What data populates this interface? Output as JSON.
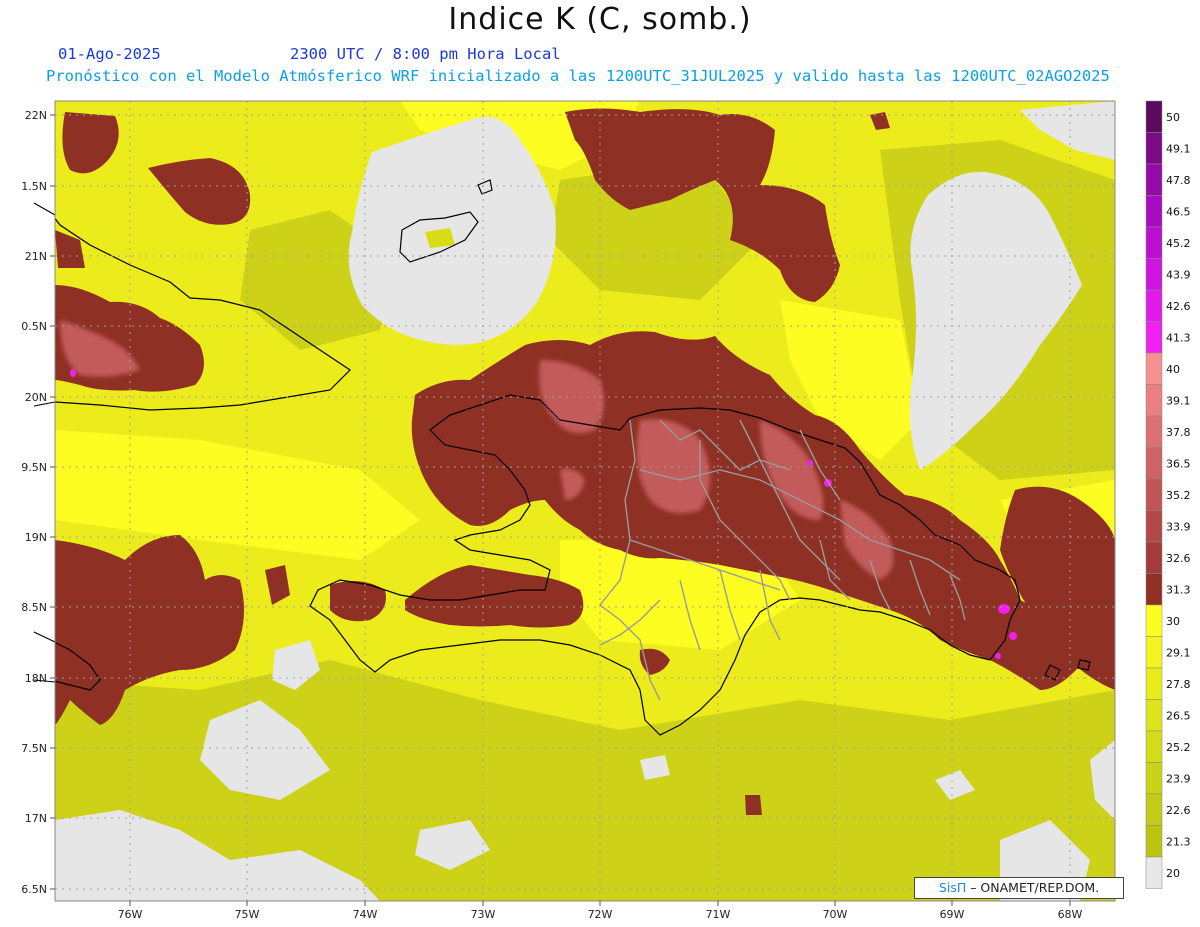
{
  "header": {
    "title": "Indice K (C, somb.)",
    "date": "01-Ago-2025",
    "time": "2300 UTC / 8:00 pm Hora Local",
    "description": "Pronóstico con el Modelo Atmósferico WRF inicializado a las 1200UTC_31JUL2025 y valido hasta las  1200UTC_02AGO2025"
  },
  "axes": {
    "lat_labels": [
      "22N",
      "1.5N",
      "21N",
      "0.5N",
      "20N",
      "9.5N",
      "19N",
      "8.5N",
      "18N",
      "7.5N",
      "17N",
      "6.5N"
    ],
    "lon_labels": [
      "76W",
      "75W",
      "74W",
      "73W",
      "72W",
      "71W",
      "70W",
      "69W",
      "68W"
    ]
  },
  "colorbar": {
    "labels": [
      "50",
      "49.1",
      "47.8",
      "46.5",
      "45.2",
      "43.9",
      "42.6",
      "41.3",
      "40",
      "39.1",
      "37.8",
      "36.5",
      "35.2",
      "33.9",
      "32.6",
      "31.3",
      "30",
      "29.1",
      "27.8",
      "26.5",
      "25.2",
      "23.9",
      "22.6",
      "21.3",
      "20"
    ],
    "colors": [
      "#5c0a5e",
      "#7a0a86",
      "#930aa6",
      "#a80cc0",
      "#bd0fd2",
      "#cf14de",
      "#e01ae8",
      "#f020f0",
      "#f59090",
      "#ec8080",
      "#dd7070",
      "#cf6262",
      "#c05555",
      "#b24848",
      "#a33b3b",
      "#8f3024",
      "#ffff20",
      "#f4f41e",
      "#e9ec1c",
      "#dde41a",
      "#d2dc18",
      "#c9d416",
      "#c2cc14",
      "#bcc412",
      "#e8e8e8"
    ]
  },
  "credit": {
    "brand": "SisΠ",
    "text": " –  ONAMET/REP.DOM."
  }
}
